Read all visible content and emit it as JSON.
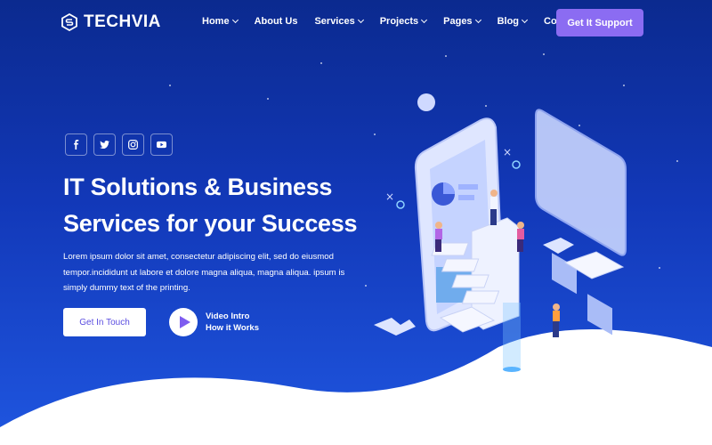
{
  "brand": {
    "name": "TECHVIA"
  },
  "nav": {
    "items": [
      {
        "label": "Home",
        "dropdown": true
      },
      {
        "label": "About Us",
        "dropdown": false
      },
      {
        "label": "Services",
        "dropdown": true
      },
      {
        "label": "Projects",
        "dropdown": true
      },
      {
        "label": "Pages",
        "dropdown": true
      },
      {
        "label": "Blog",
        "dropdown": true
      },
      {
        "label": "Contact",
        "dropdown": false
      }
    ],
    "cta_label": "Get It Support"
  },
  "socials": [
    "facebook-icon",
    "twitter-icon",
    "instagram-icon",
    "youtube-icon"
  ],
  "hero": {
    "title_line1": "IT Solutions & Business",
    "title_line2": "Services for your Success",
    "text": "Lorem ipsum dolor sit amet, consectetur adipiscing elit, sed do eiusmod tempor.incididunt ut labore et dolore magna aliqua, magna aliqua. ipsum is simply dummy text of the printing.",
    "cta_label": "Get In Touch",
    "video_line1": "Video Intro",
    "video_line2": "How it Works"
  },
  "colors": {
    "bg_top": "#0b2a8f",
    "bg_bottom": "#1f56e0",
    "accent": "#8b6cf2",
    "play": "#7e5cf0"
  }
}
